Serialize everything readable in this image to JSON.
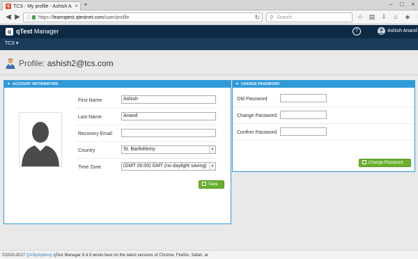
{
  "browser": {
    "tab_title": "TCS - My profile - Ashish An...",
    "tab_favicon": "q",
    "tab_close": "×",
    "new_tab": "+",
    "url_prefix": "https://",
    "url_domain": "learnqtest.qtestnet.com",
    "url_path": "/user/profile",
    "search_placeholder": "Search",
    "icons": [
      "back-icon",
      "forward-icon",
      "info-icon",
      "lock-icon",
      "reload-icon",
      "search-icon",
      "star-icon",
      "clipboard-icon",
      "download-icon",
      "home-icon",
      "shield-icon",
      "menu-icon"
    ]
  },
  "app": {
    "logo_letter": "q",
    "name_bold": "qTest",
    "name_rest": "Manager",
    "help": "?",
    "user_name": "Ashish Anand",
    "project": "TCS ▾"
  },
  "profile": {
    "title_label": "Profile: ",
    "email": "ashish2@tcs.com"
  },
  "account": {
    "header": "ACCOUNT INFORMATION",
    "first_name": {
      "label": "First Name",
      "value": "Ashish"
    },
    "last_name": {
      "label": "Last Name",
      "value": "Anand"
    },
    "recovery_email": {
      "label": "Recovery Email",
      "value": ""
    },
    "country": {
      "label": "Country",
      "value": "St. Barthélemy"
    },
    "time_zone": {
      "label": "Time Zone",
      "value": "(GMT 00:00) GMT (no daylight saving)"
    },
    "save_label": "Save"
  },
  "password": {
    "header": "CHANGE PASSWORD",
    "old": {
      "label": "Old Password",
      "value": ""
    },
    "new": {
      "label": "Change Password",
      "value": ""
    },
    "confirm": {
      "label": "Confirm Password",
      "value": ""
    },
    "button_label": "Change Password"
  },
  "footer": {
    "copyright": "©2010-2017 ",
    "company": "QASymphony",
    "note": " qTest Manager 8.4.9 works best on the latest versions of Chrome, Firefox, Safari, ar"
  },
  "colors": {
    "header_bg": "#0f2a45",
    "subheader_bg": "#1b3c5c",
    "panel_accent": "#2f9ad8",
    "button_green": "#6ab02f"
  }
}
